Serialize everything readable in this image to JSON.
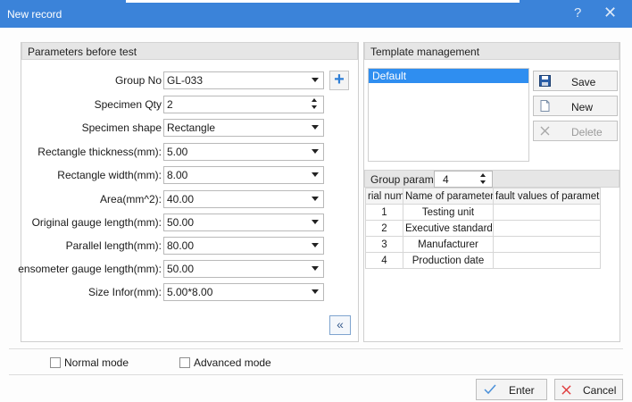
{
  "window": {
    "title": "New record",
    "help_glyph": "?",
    "close_glyph": "✕"
  },
  "params": {
    "header": "Parameters before test",
    "fields": [
      {
        "label": "Group No",
        "value": "GL-033",
        "control": "combo"
      },
      {
        "label": "Specimen Qty",
        "value": "2",
        "control": "spin"
      },
      {
        "label": "Specimen shape",
        "value": "Rectangle",
        "control": "combo"
      },
      {
        "label": "Rectangle thickness(mm):",
        "value": "5.00",
        "control": "combo"
      },
      {
        "label": "Rectangle width(mm):",
        "value": "8.00",
        "control": "combo"
      },
      {
        "label": "Area(mm^2):",
        "value": "40.00",
        "control": "combo"
      },
      {
        "label": "Original gauge length(mm):",
        "value": "50.00",
        "control": "combo"
      },
      {
        "label": "Parallel length(mm):",
        "value": "80.00",
        "control": "combo"
      },
      {
        "label": "ensometer gauge length(mm):",
        "value": "50.00",
        "control": "combo"
      },
      {
        "label": "Size Infor(mm):",
        "value": "5.00*8.00",
        "control": "combo"
      }
    ],
    "add_glyph": "+",
    "collapse_glyph": "«"
  },
  "template": {
    "header": "Template management",
    "items": [
      "Default"
    ],
    "save_label": "Save",
    "new_label": "New",
    "delete_label": "Delete"
  },
  "group_params": {
    "label": "Group parame",
    "count": "4",
    "columns": [
      "rial num",
      "Name of parameter",
      "fault values of paramet"
    ],
    "rows": [
      {
        "no": "1",
        "name": "Testing unit",
        "value": ""
      },
      {
        "no": "2",
        "name": "Executive standard",
        "value": ""
      },
      {
        "no": "3",
        "name": "Manufacturer",
        "value": ""
      },
      {
        "no": "4",
        "name": "Production date",
        "value": ""
      }
    ]
  },
  "modes": {
    "normal_label": "Normal mode",
    "advanced_label": "Advanced mode"
  },
  "footer": {
    "enter_label": "Enter",
    "cancel_label": "Cancel"
  },
  "colors": {
    "titlebar": "#3b83d9",
    "selection": "#2f8ef0",
    "accent_check": "#4a90d9",
    "cancel_x": "#e0383a"
  }
}
